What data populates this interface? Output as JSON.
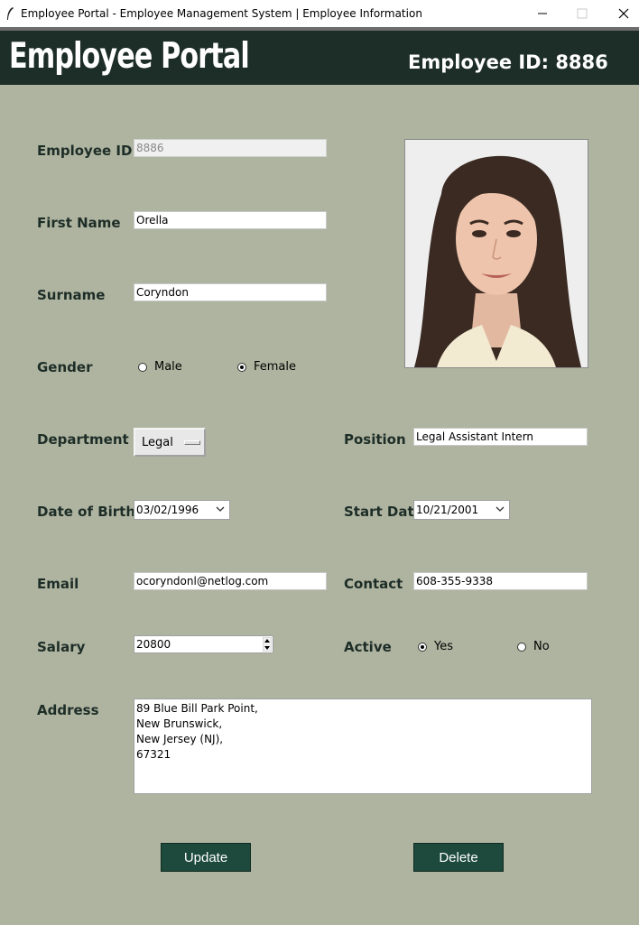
{
  "window": {
    "title": "Employee Portal - Employee Management System | Employee Information"
  },
  "header": {
    "brand": "Employee Portal",
    "employee_id_label": "Employee ID: 8886"
  },
  "form": {
    "employee_id": {
      "label": "Employee ID",
      "value": "8886"
    },
    "first_name": {
      "label": "First Name",
      "value": "Orella"
    },
    "surname": {
      "label": "Surname",
      "value": "Coryndon"
    },
    "gender": {
      "label": "Gender",
      "options": [
        "Male",
        "Female"
      ],
      "selected": "Female"
    },
    "department": {
      "label": "Department",
      "value": "Legal"
    },
    "position": {
      "label": "Position",
      "value": "Legal Assistant Intern"
    },
    "date_of_birth": {
      "label": "Date of Birth",
      "value": "03/02/1996"
    },
    "start_date": {
      "label": "Start Date",
      "value": "10/21/2001"
    },
    "email": {
      "label": "Email",
      "value": "ocoryndonl@netlog.com"
    },
    "contact": {
      "label": "Contact",
      "value": "608-355-9338"
    },
    "salary": {
      "label": "Salary",
      "value": "20800"
    },
    "active": {
      "label": "Active",
      "options": [
        "Yes",
        "No"
      ],
      "selected": "Yes"
    },
    "address": {
      "label": "Address",
      "lines": [
        "89 Blue Bill Park Point,",
        "New Brunswick,",
        "New Jersey (NJ),",
        "67321"
      ]
    }
  },
  "actions": {
    "update": "Update",
    "delete": "Delete"
  },
  "colors": {
    "background": "#afb4a0",
    "header": "#1d2d27",
    "button": "#1d4a3c"
  },
  "icons": [
    "feather-icon",
    "minimize-icon",
    "maximize-icon",
    "close-icon",
    "chevron-down-icon",
    "spin-arrows-icon",
    "photo"
  ]
}
